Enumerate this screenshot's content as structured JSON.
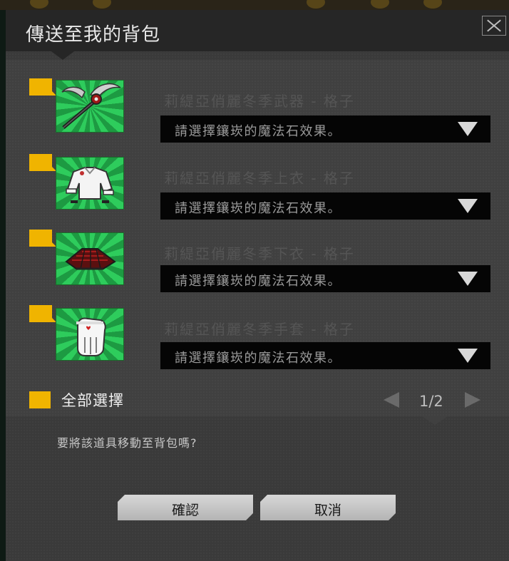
{
  "dialog": {
    "title": "傳送至我的背包"
  },
  "items": [
    {
      "name": "莉緹亞俏麗冬季武器 - 格子",
      "icon": "scythe-weapon-icon",
      "select_placeholder": "請選擇鑲崁的魔法石效果。"
    },
    {
      "name": "莉緹亞俏麗冬季上衣 - 格子",
      "icon": "winter-top-icon",
      "select_placeholder": "請選擇鑲崁的魔法石效果。"
    },
    {
      "name": "莉緹亞俏麗冬季下衣 - 格子",
      "icon": "plaid-skirt-icon",
      "select_placeholder": "請選擇鑲崁的魔法石效果。"
    },
    {
      "name": "莉緹亞俏麗冬季手套 - 格子",
      "icon": "glove-icon",
      "select_placeholder": "請選擇鑲崁的魔法石效果。"
    }
  ],
  "select_all": {
    "label": "全部選擇"
  },
  "pagination": {
    "text": "1/2"
  },
  "prompt": {
    "question": "要將該道具移動至背包嗎?"
  },
  "buttons": {
    "confirm": "確認",
    "cancel": "取消"
  },
  "colors": {
    "checkbox": "#f0b400",
    "thumb_green": "#2ecc5c",
    "dropdown_bg": "#050505"
  }
}
